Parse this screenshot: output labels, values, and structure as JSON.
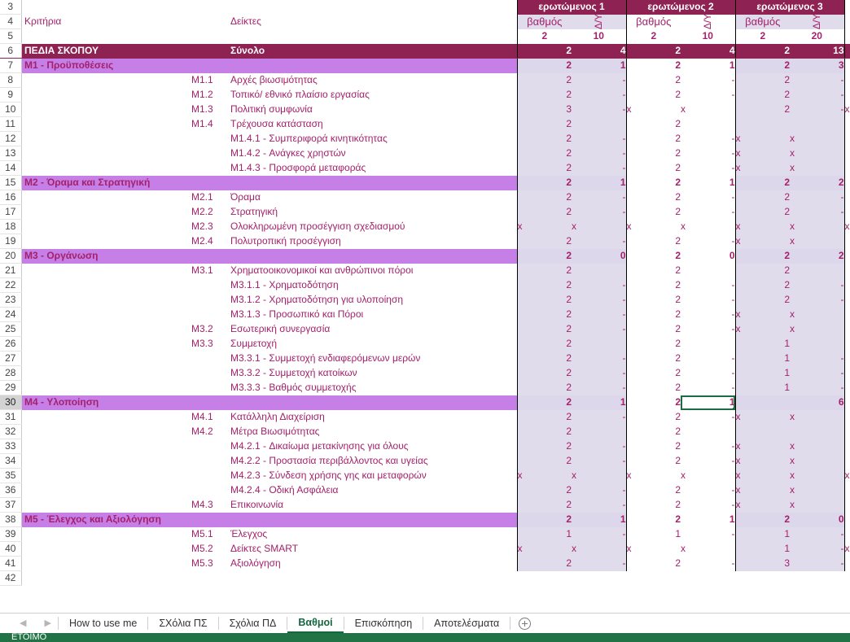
{
  "app": {
    "status_text": "ΕΤΟΙΜΟ"
  },
  "header": {
    "criteria_label": "Κριτήρια",
    "indicators_label": "Δείκτες",
    "respondents": [
      {
        "name": "ερωτώμενος 1",
        "score_label": "βαθμός",
        "dy_label": "Δ/Υ",
        "score_weight": "2",
        "dy_weight": "10"
      },
      {
        "name": "ερωτώμενος 2",
        "score_label": "βαθμός",
        "dy_label": "Δ/Υ",
        "score_weight": "2",
        "dy_weight": "10"
      },
      {
        "name": "ερωτώμενος 3",
        "score_label": "βαθμός",
        "dy_label": "Δ/Υ",
        "score_weight": "2",
        "dy_weight": "20"
      }
    ]
  },
  "rows": [
    {
      "n": "3",
      "type": "blank"
    },
    {
      "n": "4",
      "type": "header"
    },
    {
      "n": "5",
      "type": "weights"
    },
    {
      "n": "6",
      "type": "total",
      "criteria": "ΠΕΔΙΑ ΣΚΟΠΟΥ",
      "code": "",
      "indicator": "Σύνολο",
      "cells": [
        "2",
        "4",
        "2",
        "4",
        "2",
        "13"
      ],
      "tail": ""
    },
    {
      "n": "7",
      "type": "section",
      "criteria": "M1 - Προϋποθέσεις",
      "code": "",
      "indicator": "",
      "cells": [
        "2",
        "1",
        "2",
        "1",
        "2",
        "3"
      ],
      "tail": ""
    },
    {
      "n": "8",
      "type": "data",
      "criteria": "",
      "code": "M1.1",
      "indicator": "Αρχές βιωσιμότητας",
      "cells": [
        "2",
        "-",
        "2",
        "-",
        "2",
        "-"
      ],
      "tail": ""
    },
    {
      "n": "9",
      "type": "data",
      "criteria": "",
      "code": "M1.2",
      "indicator": "Τοπικό/ εθνικό πλαίσιο εργασίας",
      "cells": [
        "2",
        "-",
        "2",
        "-",
        "2",
        "-"
      ],
      "tail": ""
    },
    {
      "n": "10",
      "type": "data",
      "criteria": "",
      "code": "M1.3",
      "indicator": "Πολιτική συμφωνία",
      "cells": [
        "3",
        "-",
        "x",
        "x",
        "2",
        "-"
      ],
      "tail": "x"
    },
    {
      "n": "11",
      "type": "data",
      "criteria": "",
      "code": "M1.4",
      "indicator": "Τρέχουσα κατάσταση",
      "cells": [
        "2",
        "",
        "2",
        "",
        "",
        ""
      ],
      "tail": ""
    },
    {
      "n": "12",
      "type": "data",
      "criteria": "",
      "code": "",
      "indicator": "M1.4.1 - Συμπεριφορά κινητικότητας",
      "cells": [
        "2",
        "-",
        "2",
        "-",
        "x",
        "x"
      ],
      "tail": ""
    },
    {
      "n": "13",
      "type": "data",
      "criteria": "",
      "code": "",
      "indicator": "M1.4.2 - Ανάγκες χρηστών",
      "cells": [
        "2",
        "-",
        "2",
        "-",
        "x",
        "x"
      ],
      "tail": ""
    },
    {
      "n": "14",
      "type": "data",
      "criteria": "",
      "code": "",
      "indicator": "M1.4.3 - Προσφορά μεταφοράς",
      "cells": [
        "2",
        "-",
        "2",
        "-",
        "x",
        "x"
      ],
      "tail": ""
    },
    {
      "n": "15",
      "type": "section",
      "criteria": "M2 - Όραμα και Στρατηγική",
      "code": "",
      "indicator": "",
      "cells": [
        "2",
        "1",
        "2",
        "1",
        "2",
        "2"
      ],
      "tail": ""
    },
    {
      "n": "16",
      "type": "data",
      "criteria": "",
      "code": "M2.1",
      "indicator": "Όραμα",
      "cells": [
        "2",
        "-",
        "2",
        "-",
        "2",
        "-"
      ],
      "tail": ""
    },
    {
      "n": "17",
      "type": "data",
      "criteria": "",
      "code": "M2.2",
      "indicator": "Στρατηγική",
      "cells": [
        "2",
        "-",
        "2",
        "-",
        "2",
        "-"
      ],
      "tail": ""
    },
    {
      "n": "18",
      "type": "data",
      "criteria": "",
      "code": "M2.3",
      "indicator": "Ολοκληρωμένη προσέγγιση σχεδιασμού",
      "cells": [
        "x",
        "x",
        "x",
        "x",
        "x",
        "x"
      ],
      "tail": "x"
    },
    {
      "n": "19",
      "type": "data",
      "criteria": "",
      "code": "M2.4",
      "indicator": "Πολυτροπική προσέγγιση",
      "cells": [
        "2",
        "-",
        "2",
        "-",
        "x",
        "x"
      ],
      "tail": ""
    },
    {
      "n": "20",
      "type": "section",
      "criteria": "M3 - Οργάνωση",
      "code": "",
      "indicator": "",
      "cells": [
        "2",
        "0",
        "2",
        "0",
        "2",
        "2"
      ],
      "tail": ""
    },
    {
      "n": "21",
      "type": "data",
      "criteria": "",
      "code": "M3.1",
      "indicator": "Χρηματοοικονομικοί και ανθρώπινοι πόροι",
      "cells": [
        "2",
        "",
        "2",
        "",
        "2",
        ""
      ],
      "tail": ""
    },
    {
      "n": "22",
      "type": "data",
      "criteria": "",
      "code": "",
      "indicator": "M3.1.1 - Χρηματοδότηση",
      "cells": [
        "2",
        "-",
        "2",
        "-",
        "2",
        "-"
      ],
      "tail": ""
    },
    {
      "n": "23",
      "type": "data",
      "criteria": "",
      "code": "",
      "indicator": "M3.1.2 - Χρηματοδότηση για υλοποίηση",
      "cells": [
        "2",
        "-",
        "2",
        "-",
        "2",
        "-"
      ],
      "tail": ""
    },
    {
      "n": "24",
      "type": "data",
      "criteria": "",
      "code": "",
      "indicator": "M3.1.3 - Προσωπικό και Πόροι",
      "cells": [
        "2",
        "-",
        "2",
        "-",
        "x",
        "x"
      ],
      "tail": ""
    },
    {
      "n": "25",
      "type": "data",
      "criteria": "",
      "code": "M3.2",
      "indicator": "Εσωτερική συνεργασία",
      "cells": [
        "2",
        "-",
        "2",
        "-",
        "x",
        "x"
      ],
      "tail": ""
    },
    {
      "n": "26",
      "type": "data",
      "criteria": "",
      "code": "M3.3",
      "indicator": "Συμμετοχή",
      "cells": [
        "2",
        "",
        "2",
        "",
        "1",
        ""
      ],
      "tail": ""
    },
    {
      "n": "27",
      "type": "data",
      "criteria": "",
      "code": "",
      "indicator": "M3.3.1 - Συμμετοχή ενδιαφερόμενων μερών",
      "cells": [
        "2",
        "-",
        "2",
        "-",
        "1",
        "-"
      ],
      "tail": ""
    },
    {
      "n": "28",
      "type": "data",
      "criteria": "",
      "code": "",
      "indicator": "M3.3.2 - Συμμετοχή κατοίκων",
      "cells": [
        "2",
        "-",
        "2",
        "-",
        "1",
        "-"
      ],
      "tail": ""
    },
    {
      "n": "29",
      "type": "data",
      "criteria": "",
      "code": "",
      "indicator": "M3.3.3 - Βαθμός συμμετοχής",
      "cells": [
        "2",
        "-",
        "2",
        "-",
        "1",
        "-"
      ],
      "tail": ""
    },
    {
      "n": "30",
      "type": "section",
      "criteria": "M4 - Υλοποίηση",
      "code": "",
      "indicator": "",
      "cells": [
        "2",
        "1",
        "2",
        "1",
        "",
        "6"
      ],
      "tail": "",
      "selected_cell": 3
    },
    {
      "n": "31",
      "type": "data",
      "criteria": "",
      "code": "M4.1",
      "indicator": "Κατάλληλη Διαχείριση",
      "cells": [
        "2",
        "-",
        "2",
        "-",
        "x",
        "x"
      ],
      "tail": ""
    },
    {
      "n": "32",
      "type": "data",
      "criteria": "",
      "code": "M4.2",
      "indicator": "Μέτρα Βιωσιμότητας",
      "cells": [
        "2",
        "",
        "2",
        "",
        "",
        ""
      ],
      "tail": ""
    },
    {
      "n": "33",
      "type": "data",
      "criteria": "",
      "code": "",
      "indicator": "M4.2.1 - Δικαίωμα μετακίνησης για όλους",
      "cells": [
        "2",
        "-",
        "2",
        "-",
        "x",
        "x"
      ],
      "tail": ""
    },
    {
      "n": "34",
      "type": "data",
      "criteria": "",
      "code": "",
      "indicator": "M4.2.2 - Προστασία περιβάλλοντος και υγείας",
      "cells": [
        "2",
        "-",
        "2",
        "-",
        "x",
        "x"
      ],
      "tail": ""
    },
    {
      "n": "35",
      "type": "data",
      "criteria": "",
      "code": "",
      "indicator": "M4.2.3 - Σύνδεση χρήσης γης και μεταφορών",
      "cells": [
        "x",
        "x",
        "x",
        "x",
        "x",
        "x"
      ],
      "tail": "x"
    },
    {
      "n": "36",
      "type": "data",
      "criteria": "",
      "code": "",
      "indicator": "M4.2.4 - Οδική Ασφάλεια",
      "cells": [
        "2",
        "-",
        "2",
        "-",
        "x",
        "x"
      ],
      "tail": ""
    },
    {
      "n": "37",
      "type": "data",
      "criteria": "",
      "code": "M4.3",
      "indicator": "Επικοινωνία",
      "cells": [
        "2",
        "-",
        "2",
        "-",
        "x",
        "x"
      ],
      "tail": ""
    },
    {
      "n": "38",
      "type": "section",
      "criteria": "M5 - Έλεγχος και Αξιολόγηση",
      "code": "",
      "indicator": "",
      "cells": [
        "2",
        "1",
        "2",
        "1",
        "2",
        "0"
      ],
      "tail": ""
    },
    {
      "n": "39",
      "type": "data",
      "criteria": "",
      "code": "M5.1",
      "indicator": "Έλεγχος",
      "cells": [
        "1",
        "-",
        "1",
        "-",
        "1",
        "-"
      ],
      "tail": ""
    },
    {
      "n": "40",
      "type": "data",
      "criteria": "",
      "code": "M5.2",
      "indicator": "Δείκτες SMART",
      "cells": [
        "x",
        "x",
        "x",
        "x",
        "1",
        "-"
      ],
      "tail": "x"
    },
    {
      "n": "41",
      "type": "data",
      "criteria": "",
      "code": "M5.3",
      "indicator": "Αξιολόγηση",
      "cells": [
        "2",
        "-",
        "2",
        "-",
        "3",
        "-"
      ],
      "tail": ""
    },
    {
      "n": "42",
      "type": "blank2"
    }
  ],
  "tabs": {
    "prev_label": "◀",
    "next_label": "▶",
    "items": [
      {
        "label": "How to use me",
        "active": false
      },
      {
        "label": "ΣΧόλια ΠΣ",
        "active": false
      },
      {
        "label": "Σχόλια ΠΔ",
        "active": false
      },
      {
        "label": "Βαθμοί",
        "active": true
      },
      {
        "label": "Επισκόπηση",
        "active": false
      },
      {
        "label": "Αποτελέσματα",
        "active": false
      }
    ],
    "add_sheet_label": "add-sheet"
  },
  "colors": {
    "brand_dark": "#8E2353",
    "section_purple": "#C77FE8",
    "shade_lavender": "#E0DCEC",
    "text_magenta": "#A3216A",
    "excel_green": "#217346",
    "selection_green": "#1C6B42"
  }
}
